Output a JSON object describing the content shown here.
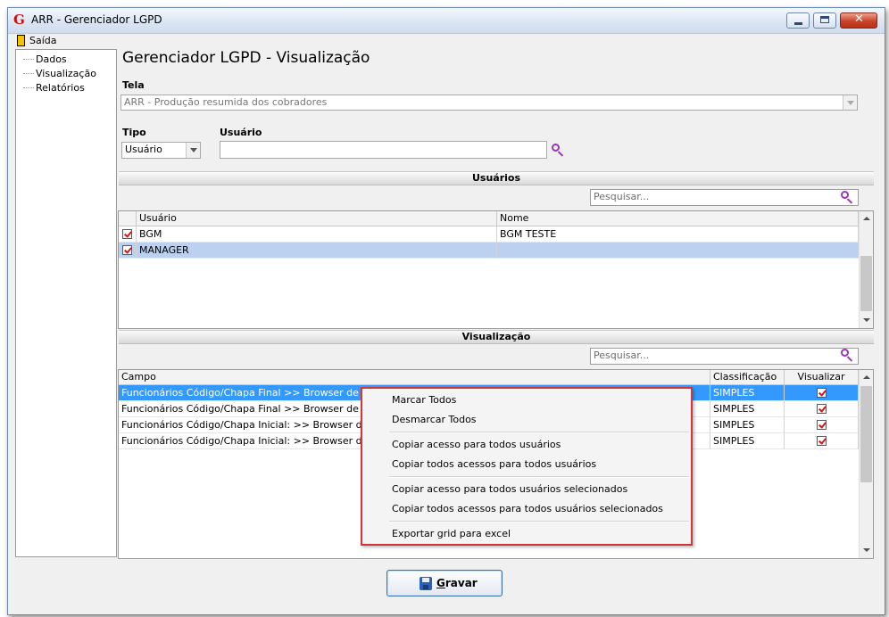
{
  "window": {
    "title": "ARR - Gerenciador LGPD",
    "app_icon": "G"
  },
  "menu": {
    "exit_label": "Saída"
  },
  "tree": {
    "items": [
      "Dados",
      "Visualização",
      "Relatórios"
    ]
  },
  "page_title": "Gerenciador LGPD - Visualização",
  "tela": {
    "label": "Tela",
    "value": "ARR - Produção resumida dos cobradores"
  },
  "tipo": {
    "label": "Tipo",
    "value": "Usuário"
  },
  "usuario": {
    "label": "Usuário",
    "value": ""
  },
  "usuarios_section": {
    "title": "Usuários",
    "search_placeholder": "Pesquisar...",
    "columns": [
      "Usuário",
      "Nome"
    ],
    "rows": [
      {
        "usuario": "BGM",
        "nome": "BGM TESTE",
        "checked": true
      },
      {
        "usuario": "MANAGER",
        "nome": "",
        "checked": true
      }
    ]
  },
  "visualizacao_section": {
    "title": "Visualização",
    "search_placeholder": "Pesquisar...",
    "columns": [
      "Campo",
      "Classificação",
      "Visualizar"
    ],
    "rows": [
      {
        "campo": "Funcionários Código/Chapa Final >> Browser de pesquisa",
        "classificacao": "SIMPLES",
        "visualizar": true
      },
      {
        "campo": "Funcionários Código/Chapa Final >> Browser de pesquisa",
        "classificacao": "SIMPLES",
        "visualizar": true
      },
      {
        "campo": "Funcionários Código/Chapa Inicial: >> Browser de pesquisa",
        "classificacao": "SIMPLES",
        "visualizar": true
      },
      {
        "campo": "Funcionários Código/Chapa Inicial: >> Browser de pesquisa",
        "classificacao": "SIMPLES",
        "visualizar": true
      }
    ]
  },
  "context_menu": {
    "items": [
      "Marcar Todos",
      "Desmarcar Todos",
      "Copiar acesso para todos usuários",
      "Copiar todos acessos para todos usuários",
      "Copiar acesso para todos usuários selecionados",
      "Copiar todos acessos para todos usuários selecionados",
      "Exportar grid para excel"
    ]
  },
  "save_button": {
    "label": "Gravar",
    "icon": "floppy-disk-icon"
  },
  "colors": {
    "selection": "#3399ff",
    "selection_inactive": "#bcd1ef",
    "highlight_border": "#d5343a",
    "search_icon": "#9a35b8"
  }
}
